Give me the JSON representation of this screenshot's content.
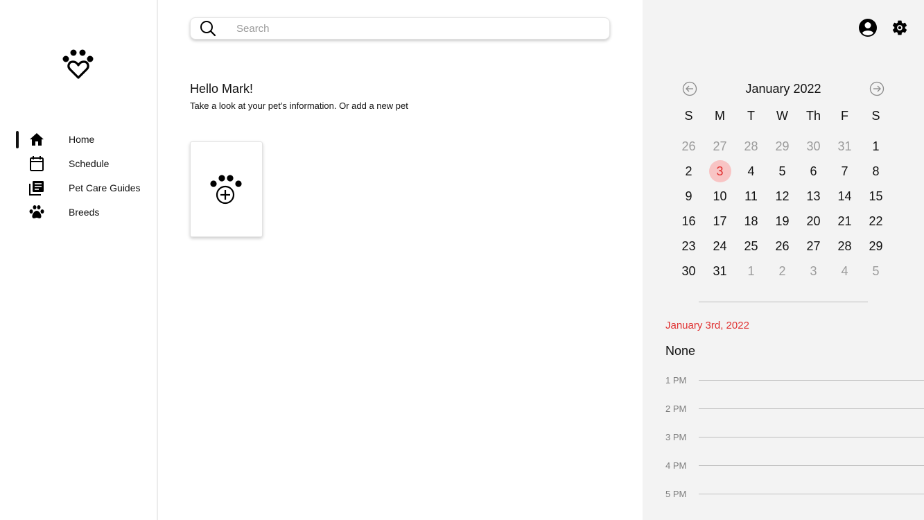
{
  "sidebar": {
    "logo_icon": "paw-heart-logo",
    "items": [
      {
        "label": "Home",
        "icon": "home-icon",
        "active": true
      },
      {
        "label": "Schedule",
        "icon": "calendar-icon",
        "active": false
      },
      {
        "label": "Pet Care Guides",
        "icon": "library-books-icon",
        "active": false
      },
      {
        "label": "Breeds",
        "icon": "paw-icon",
        "active": false
      }
    ]
  },
  "search": {
    "placeholder": "Search",
    "value": ""
  },
  "main": {
    "greeting": "Hello Mark!",
    "subtitle": "Take a look at your pet’s information. Or add a new pet",
    "add_pet_icon": "paw-plus-icon"
  },
  "header_icons": {
    "profile": "account-circle-icon",
    "settings": "gear-icon"
  },
  "calendar": {
    "month_label": "January 2022",
    "weekdays": [
      "S",
      "M",
      "T",
      "W",
      "Th",
      "F",
      "S"
    ],
    "weeks": [
      [
        {
          "d": "26",
          "m": true
        },
        {
          "d": "27",
          "m": true
        },
        {
          "d": "28",
          "m": true
        },
        {
          "d": "29",
          "m": true
        },
        {
          "d": "30",
          "m": true
        },
        {
          "d": "31",
          "m": true
        },
        {
          "d": "1"
        }
      ],
      [
        {
          "d": "2"
        },
        {
          "d": "3",
          "sel": true
        },
        {
          "d": "4"
        },
        {
          "d": "5"
        },
        {
          "d": "6"
        },
        {
          "d": "7"
        },
        {
          "d": "8"
        }
      ],
      [
        {
          "d": "9"
        },
        {
          "d": "10"
        },
        {
          "d": "11"
        },
        {
          "d": "12"
        },
        {
          "d": "13"
        },
        {
          "d": "14"
        },
        {
          "d": "15"
        }
      ],
      [
        {
          "d": "16"
        },
        {
          "d": "17"
        },
        {
          "d": "18"
        },
        {
          "d": "19"
        },
        {
          "d": "20"
        },
        {
          "d": "21"
        },
        {
          "d": "22"
        }
      ],
      [
        {
          "d": "23"
        },
        {
          "d": "24"
        },
        {
          "d": "25"
        },
        {
          "d": "26"
        },
        {
          "d": "27"
        },
        {
          "d": "28"
        },
        {
          "d": "29"
        }
      ],
      [
        {
          "d": "30"
        },
        {
          "d": "31"
        },
        {
          "d": "1",
          "m": true
        },
        {
          "d": "2",
          "m": true
        },
        {
          "d": "3",
          "m": true
        },
        {
          "d": "4",
          "m": true
        },
        {
          "d": "5",
          "m": true
        }
      ]
    ],
    "selected_color": "#e02f2f",
    "selected_bg": "#f8c4c4"
  },
  "agenda": {
    "selected_date": "January 3rd, 2022",
    "empty_text": "None",
    "times": [
      "1 PM",
      "2 PM",
      "3 PM",
      "4 PM",
      "5 PM"
    ]
  }
}
